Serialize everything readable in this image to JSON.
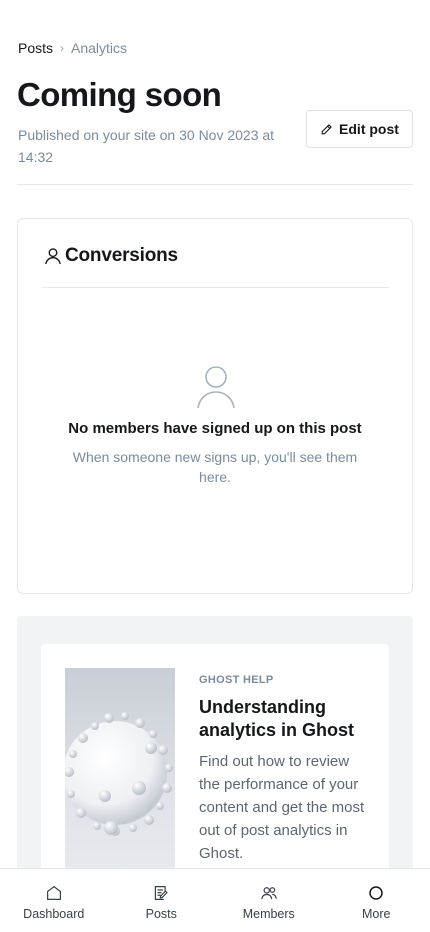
{
  "breadcrumb": {
    "parent": "Posts",
    "separator": "›",
    "current": "Analytics"
  },
  "post": {
    "title": "Coming soon",
    "published": "Published on your site on 30 Nov 2023 at 14:32"
  },
  "edit_button": {
    "label": "Edit post",
    "icon": "pencil-icon"
  },
  "conversions": {
    "title": "Conversions",
    "icon": "user-icon",
    "empty_title": "No members have signed up on this post",
    "empty_subtitle": "When someone new signs up, you'll see them here."
  },
  "help": {
    "label": "GHOST HELP",
    "title": "Understanding analytics in Ghost",
    "description": "Find out how to review the performance of your content and get the most out of post analytics in Ghost."
  },
  "tabbar": {
    "items": [
      {
        "label": "Dashboard",
        "icon": "home-icon"
      },
      {
        "label": "Posts",
        "icon": "posts-icon"
      },
      {
        "label": "Members",
        "icon": "members-icon"
      },
      {
        "label": "More",
        "icon": "circle-icon"
      }
    ]
  },
  "colors": {
    "text": "#15171a",
    "muted": "#7c8b9a",
    "border": "#e4e7ea",
    "help_bg": "#f1f3f4"
  }
}
